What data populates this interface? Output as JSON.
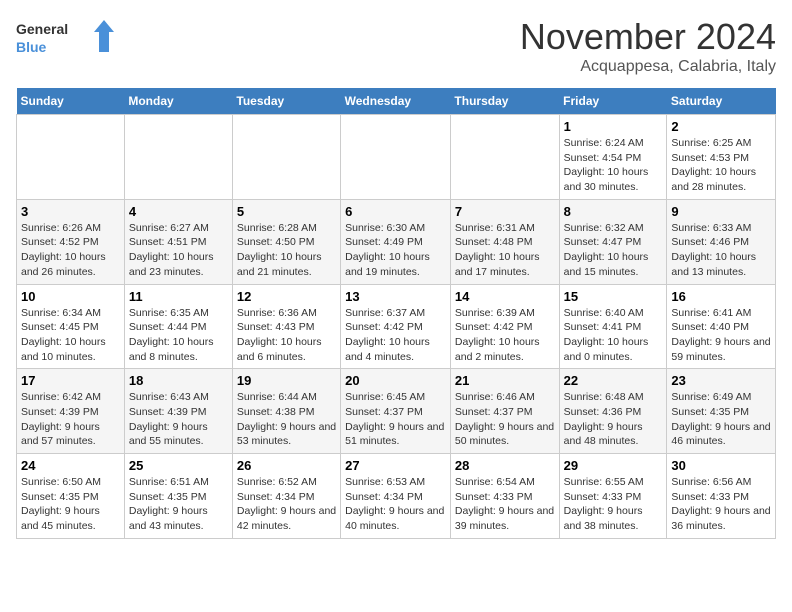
{
  "logo": {
    "line1": "General",
    "line2": "Blue"
  },
  "title": "November 2024",
  "location": "Acquappesa, Calabria, Italy",
  "weekdays": [
    "Sunday",
    "Monday",
    "Tuesday",
    "Wednesday",
    "Thursday",
    "Friday",
    "Saturday"
  ],
  "weeks": [
    [
      {
        "day": "",
        "info": ""
      },
      {
        "day": "",
        "info": ""
      },
      {
        "day": "",
        "info": ""
      },
      {
        "day": "",
        "info": ""
      },
      {
        "day": "",
        "info": ""
      },
      {
        "day": "1",
        "info": "Sunrise: 6:24 AM\nSunset: 4:54 PM\nDaylight: 10 hours and 30 minutes."
      },
      {
        "day": "2",
        "info": "Sunrise: 6:25 AM\nSunset: 4:53 PM\nDaylight: 10 hours and 28 minutes."
      }
    ],
    [
      {
        "day": "3",
        "info": "Sunrise: 6:26 AM\nSunset: 4:52 PM\nDaylight: 10 hours and 26 minutes."
      },
      {
        "day": "4",
        "info": "Sunrise: 6:27 AM\nSunset: 4:51 PM\nDaylight: 10 hours and 23 minutes."
      },
      {
        "day": "5",
        "info": "Sunrise: 6:28 AM\nSunset: 4:50 PM\nDaylight: 10 hours and 21 minutes."
      },
      {
        "day": "6",
        "info": "Sunrise: 6:30 AM\nSunset: 4:49 PM\nDaylight: 10 hours and 19 minutes."
      },
      {
        "day": "7",
        "info": "Sunrise: 6:31 AM\nSunset: 4:48 PM\nDaylight: 10 hours and 17 minutes."
      },
      {
        "day": "8",
        "info": "Sunrise: 6:32 AM\nSunset: 4:47 PM\nDaylight: 10 hours and 15 minutes."
      },
      {
        "day": "9",
        "info": "Sunrise: 6:33 AM\nSunset: 4:46 PM\nDaylight: 10 hours and 13 minutes."
      }
    ],
    [
      {
        "day": "10",
        "info": "Sunrise: 6:34 AM\nSunset: 4:45 PM\nDaylight: 10 hours and 10 minutes."
      },
      {
        "day": "11",
        "info": "Sunrise: 6:35 AM\nSunset: 4:44 PM\nDaylight: 10 hours and 8 minutes."
      },
      {
        "day": "12",
        "info": "Sunrise: 6:36 AM\nSunset: 4:43 PM\nDaylight: 10 hours and 6 minutes."
      },
      {
        "day": "13",
        "info": "Sunrise: 6:37 AM\nSunset: 4:42 PM\nDaylight: 10 hours and 4 minutes."
      },
      {
        "day": "14",
        "info": "Sunrise: 6:39 AM\nSunset: 4:42 PM\nDaylight: 10 hours and 2 minutes."
      },
      {
        "day": "15",
        "info": "Sunrise: 6:40 AM\nSunset: 4:41 PM\nDaylight: 10 hours and 0 minutes."
      },
      {
        "day": "16",
        "info": "Sunrise: 6:41 AM\nSunset: 4:40 PM\nDaylight: 9 hours and 59 minutes."
      }
    ],
    [
      {
        "day": "17",
        "info": "Sunrise: 6:42 AM\nSunset: 4:39 PM\nDaylight: 9 hours and 57 minutes."
      },
      {
        "day": "18",
        "info": "Sunrise: 6:43 AM\nSunset: 4:39 PM\nDaylight: 9 hours and 55 minutes."
      },
      {
        "day": "19",
        "info": "Sunrise: 6:44 AM\nSunset: 4:38 PM\nDaylight: 9 hours and 53 minutes."
      },
      {
        "day": "20",
        "info": "Sunrise: 6:45 AM\nSunset: 4:37 PM\nDaylight: 9 hours and 51 minutes."
      },
      {
        "day": "21",
        "info": "Sunrise: 6:46 AM\nSunset: 4:37 PM\nDaylight: 9 hours and 50 minutes."
      },
      {
        "day": "22",
        "info": "Sunrise: 6:48 AM\nSunset: 4:36 PM\nDaylight: 9 hours and 48 minutes."
      },
      {
        "day": "23",
        "info": "Sunrise: 6:49 AM\nSunset: 4:35 PM\nDaylight: 9 hours and 46 minutes."
      }
    ],
    [
      {
        "day": "24",
        "info": "Sunrise: 6:50 AM\nSunset: 4:35 PM\nDaylight: 9 hours and 45 minutes."
      },
      {
        "day": "25",
        "info": "Sunrise: 6:51 AM\nSunset: 4:35 PM\nDaylight: 9 hours and 43 minutes."
      },
      {
        "day": "26",
        "info": "Sunrise: 6:52 AM\nSunset: 4:34 PM\nDaylight: 9 hours and 42 minutes."
      },
      {
        "day": "27",
        "info": "Sunrise: 6:53 AM\nSunset: 4:34 PM\nDaylight: 9 hours and 40 minutes."
      },
      {
        "day": "28",
        "info": "Sunrise: 6:54 AM\nSunset: 4:33 PM\nDaylight: 9 hours and 39 minutes."
      },
      {
        "day": "29",
        "info": "Sunrise: 6:55 AM\nSunset: 4:33 PM\nDaylight: 9 hours and 38 minutes."
      },
      {
        "day": "30",
        "info": "Sunrise: 6:56 AM\nSunset: 4:33 PM\nDaylight: 9 hours and 36 minutes."
      }
    ]
  ]
}
